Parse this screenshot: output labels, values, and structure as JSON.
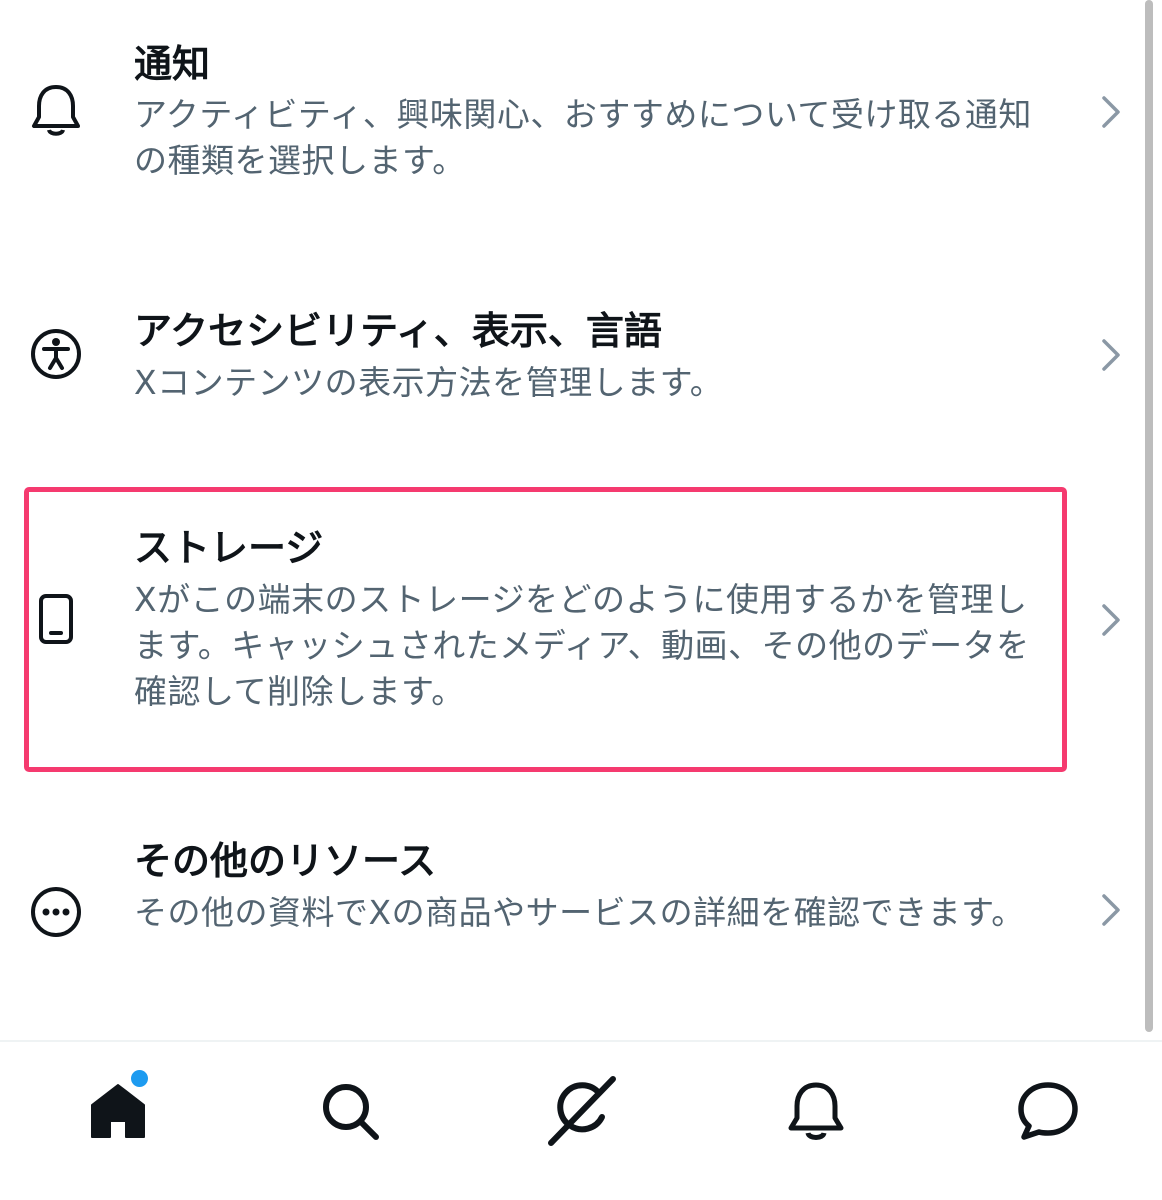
{
  "settings": {
    "items": [
      {
        "title": "通知",
        "description": "アクティビティ、興味関心、おすすめについて受け取る通知の種類を選択します。",
        "icon": "bell-icon"
      },
      {
        "title": "アクセシビリティ、表示、言語",
        "description": "Xコンテンツの表示方法を管理します。",
        "icon": "accessibility-icon"
      },
      {
        "title": "ストレージ",
        "description": "Xがこの端末のストレージをどのように使用するかを管理します。キャッシュされたメディア、動画、その他のデータを確認して削除します。",
        "icon": "phone-icon",
        "highlighted": true
      },
      {
        "title": "その他のリソース",
        "description": "その他の資料でXの商品やサービスの詳細を確認できます。",
        "icon": "more-circle-icon"
      }
    ]
  },
  "tabbar": {
    "tabs": [
      "home-icon",
      "search-icon",
      "grok-icon",
      "notifications-icon",
      "messages-icon"
    ],
    "home_has_unread_dot": true
  },
  "colors": {
    "title": "#0f1419",
    "description": "#536471",
    "highlight_border": "#f53a6f",
    "accent": "#1d9bf0"
  }
}
